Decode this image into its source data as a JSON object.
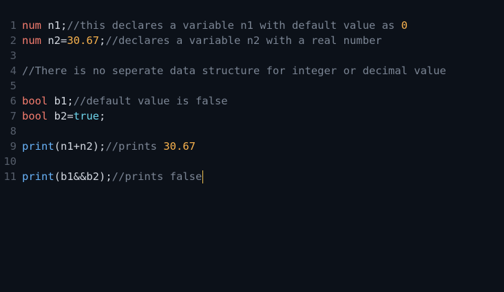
{
  "colors": {
    "background": "#0c1119",
    "line_number": "#565e6b",
    "keyword": "#f47c6e",
    "identifier": "#d3d8e0",
    "number": "#f8b24e",
    "comment": "#7b8594",
    "function": "#68b2f8",
    "literal": "#6ed5ec",
    "cursor": "#f3c453"
  },
  "lines": [
    {
      "n": "1",
      "kw": "num",
      "rest": " n1;",
      "comment": "//this declares a variable n1 with default value as ",
      "num": "0"
    },
    {
      "n": "2",
      "kw": "num",
      "rest": " n2=",
      "num": "30.67",
      "semi": ";",
      "comment": "//declares a variable n2 with a real number"
    },
    {
      "n": "3"
    },
    {
      "n": "4",
      "comment": "//There is no seperate data structure for integer or decimal value"
    },
    {
      "n": "5"
    },
    {
      "n": "6",
      "kw": "bool",
      "rest": " b1;",
      "comment": "//default value is false"
    },
    {
      "n": "7",
      "kw": "bool",
      "rest": " b2=",
      "lit": "true",
      "semi": ";"
    },
    {
      "n": "8"
    },
    {
      "n": "9",
      "fn": "print",
      "rest": "(n1+n2);",
      "comment": "//prints ",
      "num": "30.67"
    },
    {
      "n": "10"
    },
    {
      "n": "11",
      "fn": "print",
      "rest": "(b1&&b2);",
      "comment": "//prints false"
    }
  ]
}
